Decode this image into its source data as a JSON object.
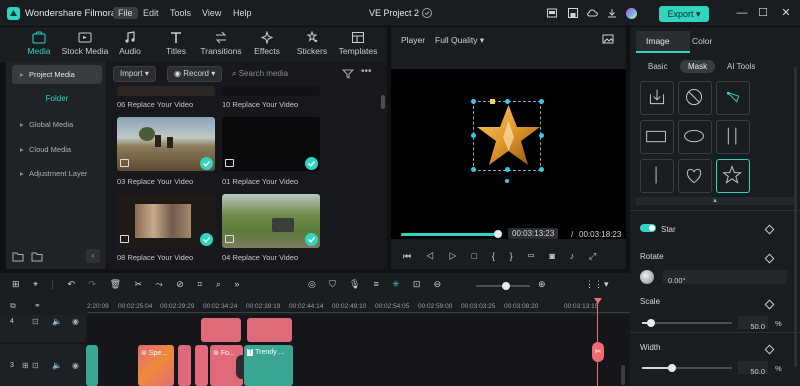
{
  "app": {
    "name": "Wondershare Filmora",
    "project_title": "VE Project 2"
  },
  "menu": [
    "File",
    "Edit",
    "Tools",
    "View",
    "Help"
  ],
  "export_label": "Export",
  "media_tabs": [
    {
      "label": "Media",
      "icon": "media-icon"
    },
    {
      "label": "Stock Media",
      "icon": "stock-media-icon"
    },
    {
      "label": "Audio",
      "icon": "audio-icon"
    },
    {
      "label": "Titles",
      "icon": "titles-icon"
    },
    {
      "label": "Transitions",
      "icon": "transitions-icon"
    },
    {
      "label": "Effects",
      "icon": "effects-icon"
    },
    {
      "label": "Stickers",
      "icon": "stickers-icon"
    },
    {
      "label": "Templates",
      "icon": "templates-icon"
    }
  ],
  "media_nav": {
    "project_media": "Project Media",
    "folder": "Folder",
    "global_media": "Global Media",
    "cloud_media": "Cloud Media",
    "adjustment_layer": "Adjustment Layer"
  },
  "media_toolbar": {
    "import": "Import",
    "record": "Record",
    "search_placeholder": "Search media"
  },
  "media_items": [
    {
      "caption": "06 Replace Your Video"
    },
    {
      "caption": "10 Replace Your Video"
    },
    {
      "caption": "03 Replace Your Video"
    },
    {
      "caption": "01 Replace Your Video"
    },
    {
      "caption": "08 Replace Your Video"
    },
    {
      "caption": "04 Replace Your Video"
    }
  ],
  "player": {
    "label": "Player",
    "quality": "Full Quality",
    "current_time": "00:03:13:23",
    "separator": "/",
    "total_time": "00:03:18:23",
    "progress": 0.97
  },
  "props": {
    "tabs": [
      "Image",
      "Color"
    ],
    "subtabs": [
      "Basic",
      "Mask",
      "AI Tools"
    ],
    "mask_shape": "Star",
    "rotate_label": "Rotate",
    "rotate_value": "0.00°",
    "scale_label": "Scale",
    "scale_value": "50.0",
    "scale_unit": "%",
    "scale_fraction": 0.1,
    "width_label": "Width",
    "width_value": "50.0",
    "width_unit": "%",
    "width_fraction": 0.33
  },
  "timeline": {
    "ticks": [
      "2:20:09",
      "00:02:25:04",
      "00:02:29:29",
      "00:02:34:24",
      "00:02:39:19",
      "00:02:44:14",
      "00:02:49:10",
      "00:02:54:05",
      "00:02:59:00",
      "00:03:03:25",
      "00:03:08:20",
      "00:03:13:15"
    ],
    "track_4": "4",
    "track_3": "3",
    "clips": [
      {
        "label": "Spe..."
      },
      {
        "label": "Fo..."
      },
      {
        "label": "Trendy ..."
      }
    ]
  },
  "colors": {
    "accent": "#2fd5bf",
    "clip_pink": "#e0697a",
    "clip_teal": "#3aa795"
  }
}
